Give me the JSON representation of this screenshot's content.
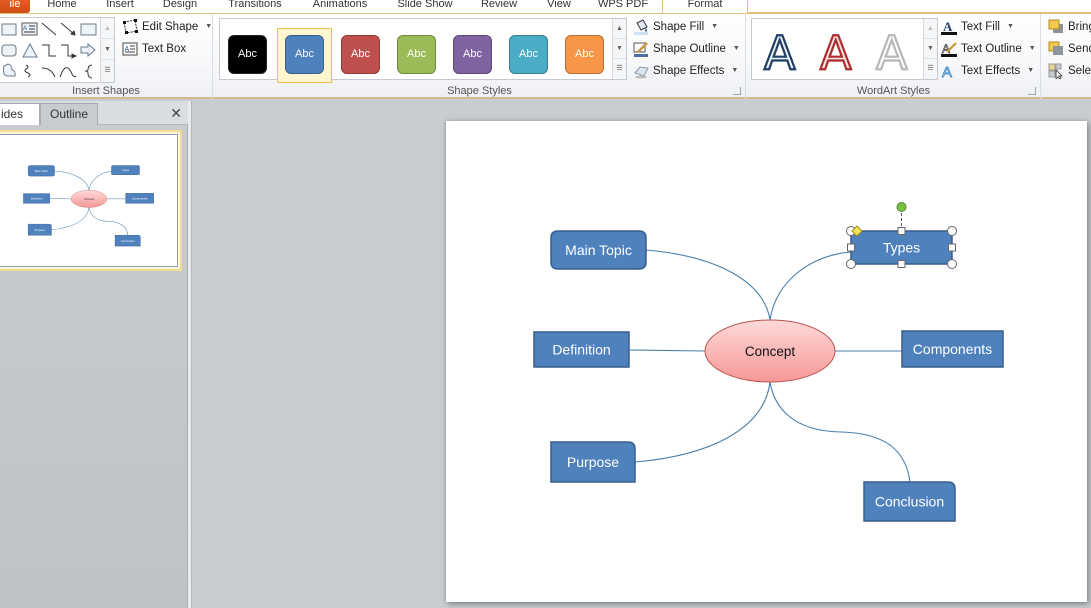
{
  "ribbon_tabs": [
    {
      "id": "file",
      "label": "File",
      "visible_label": "ile"
    },
    {
      "id": "home",
      "label": "Home"
    },
    {
      "id": "insert",
      "label": "Insert"
    },
    {
      "id": "design",
      "label": "Design"
    },
    {
      "id": "transitions",
      "label": "Transitions"
    },
    {
      "id": "animations",
      "label": "Animations"
    },
    {
      "id": "slideshow",
      "label": "Slide Show"
    },
    {
      "id": "review",
      "label": "Review"
    },
    {
      "id": "view",
      "label": "View"
    },
    {
      "id": "wpspdf",
      "label": "WPS PDF"
    },
    {
      "id": "format",
      "label": "Format",
      "active": true
    }
  ],
  "groups": {
    "insert_shapes": {
      "label": "Insert Shapes",
      "edit_shape": "Edit Shape",
      "text_box": "Text Box",
      "shape_icons": [
        "rectangle-icon",
        "text-box-icon",
        "line-icon",
        "arrow-line-icon",
        "rectangle-icon",
        "rounded-rectangle-icon",
        "triangle-icon",
        "elbow-connector-icon",
        "elbow-arrow-connector-icon",
        "right-arrow-icon",
        "freeform-icon",
        "scribble-icon",
        "arc-icon",
        "curve-icon",
        "brace-icon"
      ]
    },
    "shape_styles": {
      "label": "Shape Styles",
      "swatches": [
        {
          "label": "Abc",
          "color": "#000000",
          "border": "#222222",
          "selected": false
        },
        {
          "label": "Abc",
          "color": "#4f81bd",
          "border": "#385d8a",
          "selected": true
        },
        {
          "label": "Abc",
          "color": "#c0504d",
          "border": "#8c3836",
          "selected": false
        },
        {
          "label": "Abc",
          "color": "#9bbb59",
          "border": "#71893f",
          "selected": false
        },
        {
          "label": "Abc",
          "color": "#8064a2",
          "border": "#5c4776",
          "selected": false
        },
        {
          "label": "Abc",
          "color": "#4bacc6",
          "border": "#357d91",
          "selected": false
        },
        {
          "label": "Abc",
          "color": "#f79646",
          "border": "#b66d31",
          "selected": false
        }
      ],
      "shape_fill": "Shape Fill",
      "shape_outline": "Shape Outline",
      "shape_effects": "Shape Effects"
    },
    "wordart_styles": {
      "label": "WordArt Styles",
      "letters": [
        {
          "char": "A",
          "fill": "#eef2f6",
          "stroke": "#1f3f66"
        },
        {
          "char": "A",
          "fill": "#f4e6e6",
          "stroke": "#b02c2c"
        },
        {
          "char": "A",
          "fill": "#ffffff",
          "stroke": "#b7b7b7"
        }
      ],
      "text_fill": "Text Fill",
      "text_outline": "Text Outline",
      "text_effects": "Text Effects"
    },
    "arrange": {
      "bring_forward": "Bring",
      "send_backward": "Send",
      "selection_pane": "Sele"
    }
  },
  "left_panel": {
    "tabs": [
      {
        "label": "Slides",
        "visible_label": "ides",
        "active": true
      },
      {
        "label": "Outline",
        "active": false
      }
    ],
    "close": "✕",
    "thumbnail_count": 1
  },
  "slide": {
    "colors": {
      "node_fill": "#4f81bd",
      "node_stroke": "#385d8a",
      "connector": "#4a7eaa",
      "concept_fill_top": "#ffd9d9",
      "concept_fill_bottom": "#f59896",
      "concept_stroke": "#b85450"
    },
    "center": {
      "label": "Concept"
    },
    "nodes": [
      {
        "id": "main-topic",
        "label": "Main Topic",
        "shape": "rounded"
      },
      {
        "id": "types",
        "label": "Types",
        "shape": "rounded-small",
        "selected": true
      },
      {
        "id": "definition",
        "label": "Definition",
        "shape": "rect"
      },
      {
        "id": "components",
        "label": "Components",
        "shape": "rect"
      },
      {
        "id": "purpose",
        "label": "Purpose",
        "shape": "round-top-right"
      },
      {
        "id": "conclusion",
        "label": "Conclusion",
        "shape": "round-top-right"
      }
    ]
  }
}
